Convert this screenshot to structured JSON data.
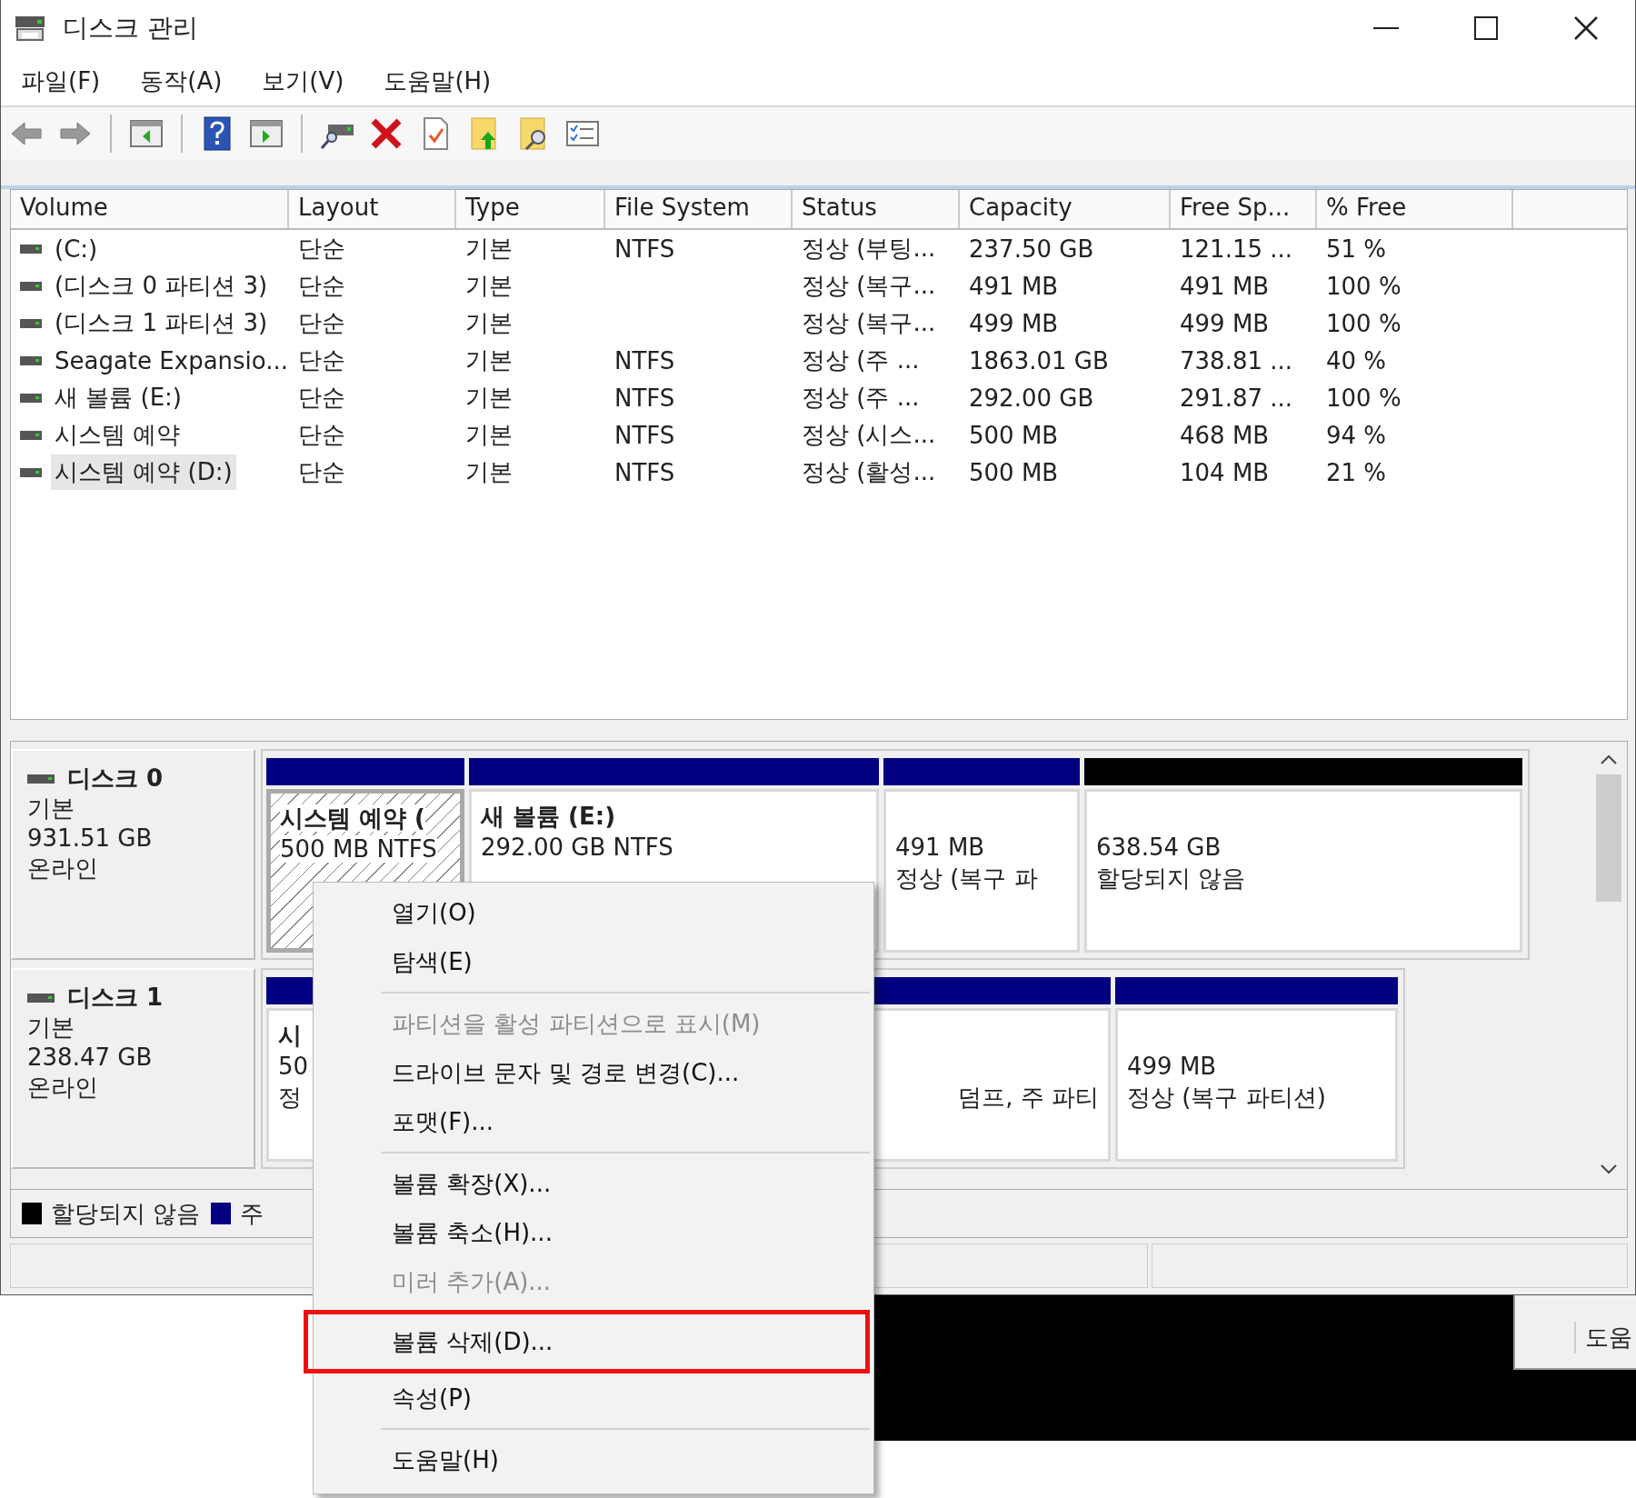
{
  "window": {
    "title": "디스크 관리"
  },
  "menu_bar": [
    "파일(F)",
    "동작(A)",
    "보기(V)",
    "도움말(H)"
  ],
  "volume_table": {
    "columns": [
      "Volume",
      "Layout",
      "Type",
      "File System",
      "Status",
      "Capacity",
      "Free Sp...",
      "% Free"
    ],
    "rows": [
      {
        "volume": "(C:)",
        "layout": "단순",
        "type": "기본",
        "file_system": "NTFS",
        "status": "정상 (부팅...",
        "capacity": "237.50 GB",
        "free_space": "121.15 ...",
        "percent_free": "51 %",
        "selected": false
      },
      {
        "volume": "(디스크 0 파티션 3)",
        "layout": "단순",
        "type": "기본",
        "status": "정상 (복구...",
        "capacity": "491 MB",
        "free_space": "491 MB",
        "percent_free": "100 %",
        "selected": false
      },
      {
        "volume": "(디스크 1 파티션 3)",
        "layout": "단순",
        "type": "기본",
        "status": "정상 (복구...",
        "capacity": "499 MB",
        "free_space": "499 MB",
        "percent_free": "100 %",
        "selected": false
      },
      {
        "volume": "Seagate Expansio...",
        "layout": "단순",
        "type": "기본",
        "file_system": "NTFS",
        "status": "정상 (주 ...",
        "capacity": "1863.01 GB",
        "free_space": "738.81 ...",
        "percent_free": "40 %",
        "selected": false
      },
      {
        "volume": "새 볼륨 (E:)",
        "layout": "단순",
        "type": "기본",
        "file_system": "NTFS",
        "status": "정상 (주 ...",
        "capacity": "292.00 GB",
        "free_space": "291.87 ...",
        "percent_free": "100 %",
        "selected": false
      },
      {
        "volume": "시스템 예약",
        "layout": "단순",
        "type": "기본",
        "file_system": "NTFS",
        "status": "정상 (시스...",
        "capacity": "500 MB",
        "free_space": "468 MB",
        "percent_free": "94 %",
        "selected": false
      },
      {
        "volume": "시스템 예약 (D:)",
        "layout": "단순",
        "type": "기본",
        "file_system": "NTFS",
        "status": "정상 (활성...",
        "capacity": "500 MB",
        "free_space": "104 MB",
        "percent_free": "21 %",
        "selected": true
      }
    ]
  },
  "disks": [
    {
      "name": "디스크 0",
      "type": "기본",
      "size": "931.51 GB",
      "status": "온라인",
      "partitions": [
        {
          "kind": "primary",
          "selected": true,
          "label": "시스템 예약 (",
          "size": "500 MB NTFS"
        },
        {
          "kind": "primary",
          "selected": false,
          "label": "새 볼륨  (E:)",
          "size": "292.00 GB NTFS"
        },
        {
          "kind": "primary",
          "selected": false,
          "size": "491 MB",
          "status": "정상 (복구 파"
        },
        {
          "kind": "unallocated",
          "selected": false,
          "size": "638.54 GB",
          "status": "할당되지 않음"
        }
      ]
    },
    {
      "name": "디스크 1",
      "type": "기본",
      "size": "238.47 GB",
      "status": "온라인",
      "partitions": [
        {
          "kind": "primary",
          "selected": false,
          "label": "시",
          "size": "50",
          "status": "정"
        },
        {
          "kind": "primary",
          "selected": false,
          "status": "덤프, 주 파티"
        },
        {
          "kind": "primary",
          "selected": false,
          "size": "499 MB",
          "status": "정상 (복구 파티션)"
        }
      ]
    }
  ],
  "legend": [
    {
      "label": "할당되지 않음",
      "color": "#000000"
    },
    {
      "label": "주",
      "color": "#000080"
    }
  ],
  "context_menu": {
    "items": [
      {
        "kind": "item",
        "label": "열기(O)",
        "disabled": false,
        "highlighted": false
      },
      {
        "kind": "item",
        "label": "탐색(E)",
        "disabled": false,
        "highlighted": false
      },
      {
        "kind": "separator"
      },
      {
        "kind": "item",
        "label": "파티션을 활성 파티션으로 표시(M)",
        "disabled": true,
        "highlighted": false
      },
      {
        "kind": "item",
        "label": "드라이브 문자 및 경로 변경(C)...",
        "disabled": false,
        "highlighted": false
      },
      {
        "kind": "item",
        "label": "포맷(F)...",
        "disabled": false,
        "highlighted": false
      },
      {
        "kind": "separator"
      },
      {
        "kind": "item",
        "label": "볼륨 확장(X)...",
        "disabled": false,
        "highlighted": false
      },
      {
        "kind": "item",
        "label": "볼륨 축소(H)...",
        "disabled": false,
        "highlighted": false
      },
      {
        "kind": "item",
        "label": "미러 추가(A)...",
        "disabled": true,
        "highlighted": false
      },
      {
        "kind": "item",
        "label": "볼륨 삭제(D)...",
        "disabled": false,
        "highlighted": true
      },
      {
        "kind": "item",
        "label": "속성(P)",
        "disabled": false,
        "highlighted": false
      },
      {
        "kind": "separator"
      },
      {
        "kind": "item",
        "label": "도움말(H)",
        "disabled": false,
        "highlighted": false
      }
    ]
  },
  "background_window": {
    "button": "도움"
  }
}
